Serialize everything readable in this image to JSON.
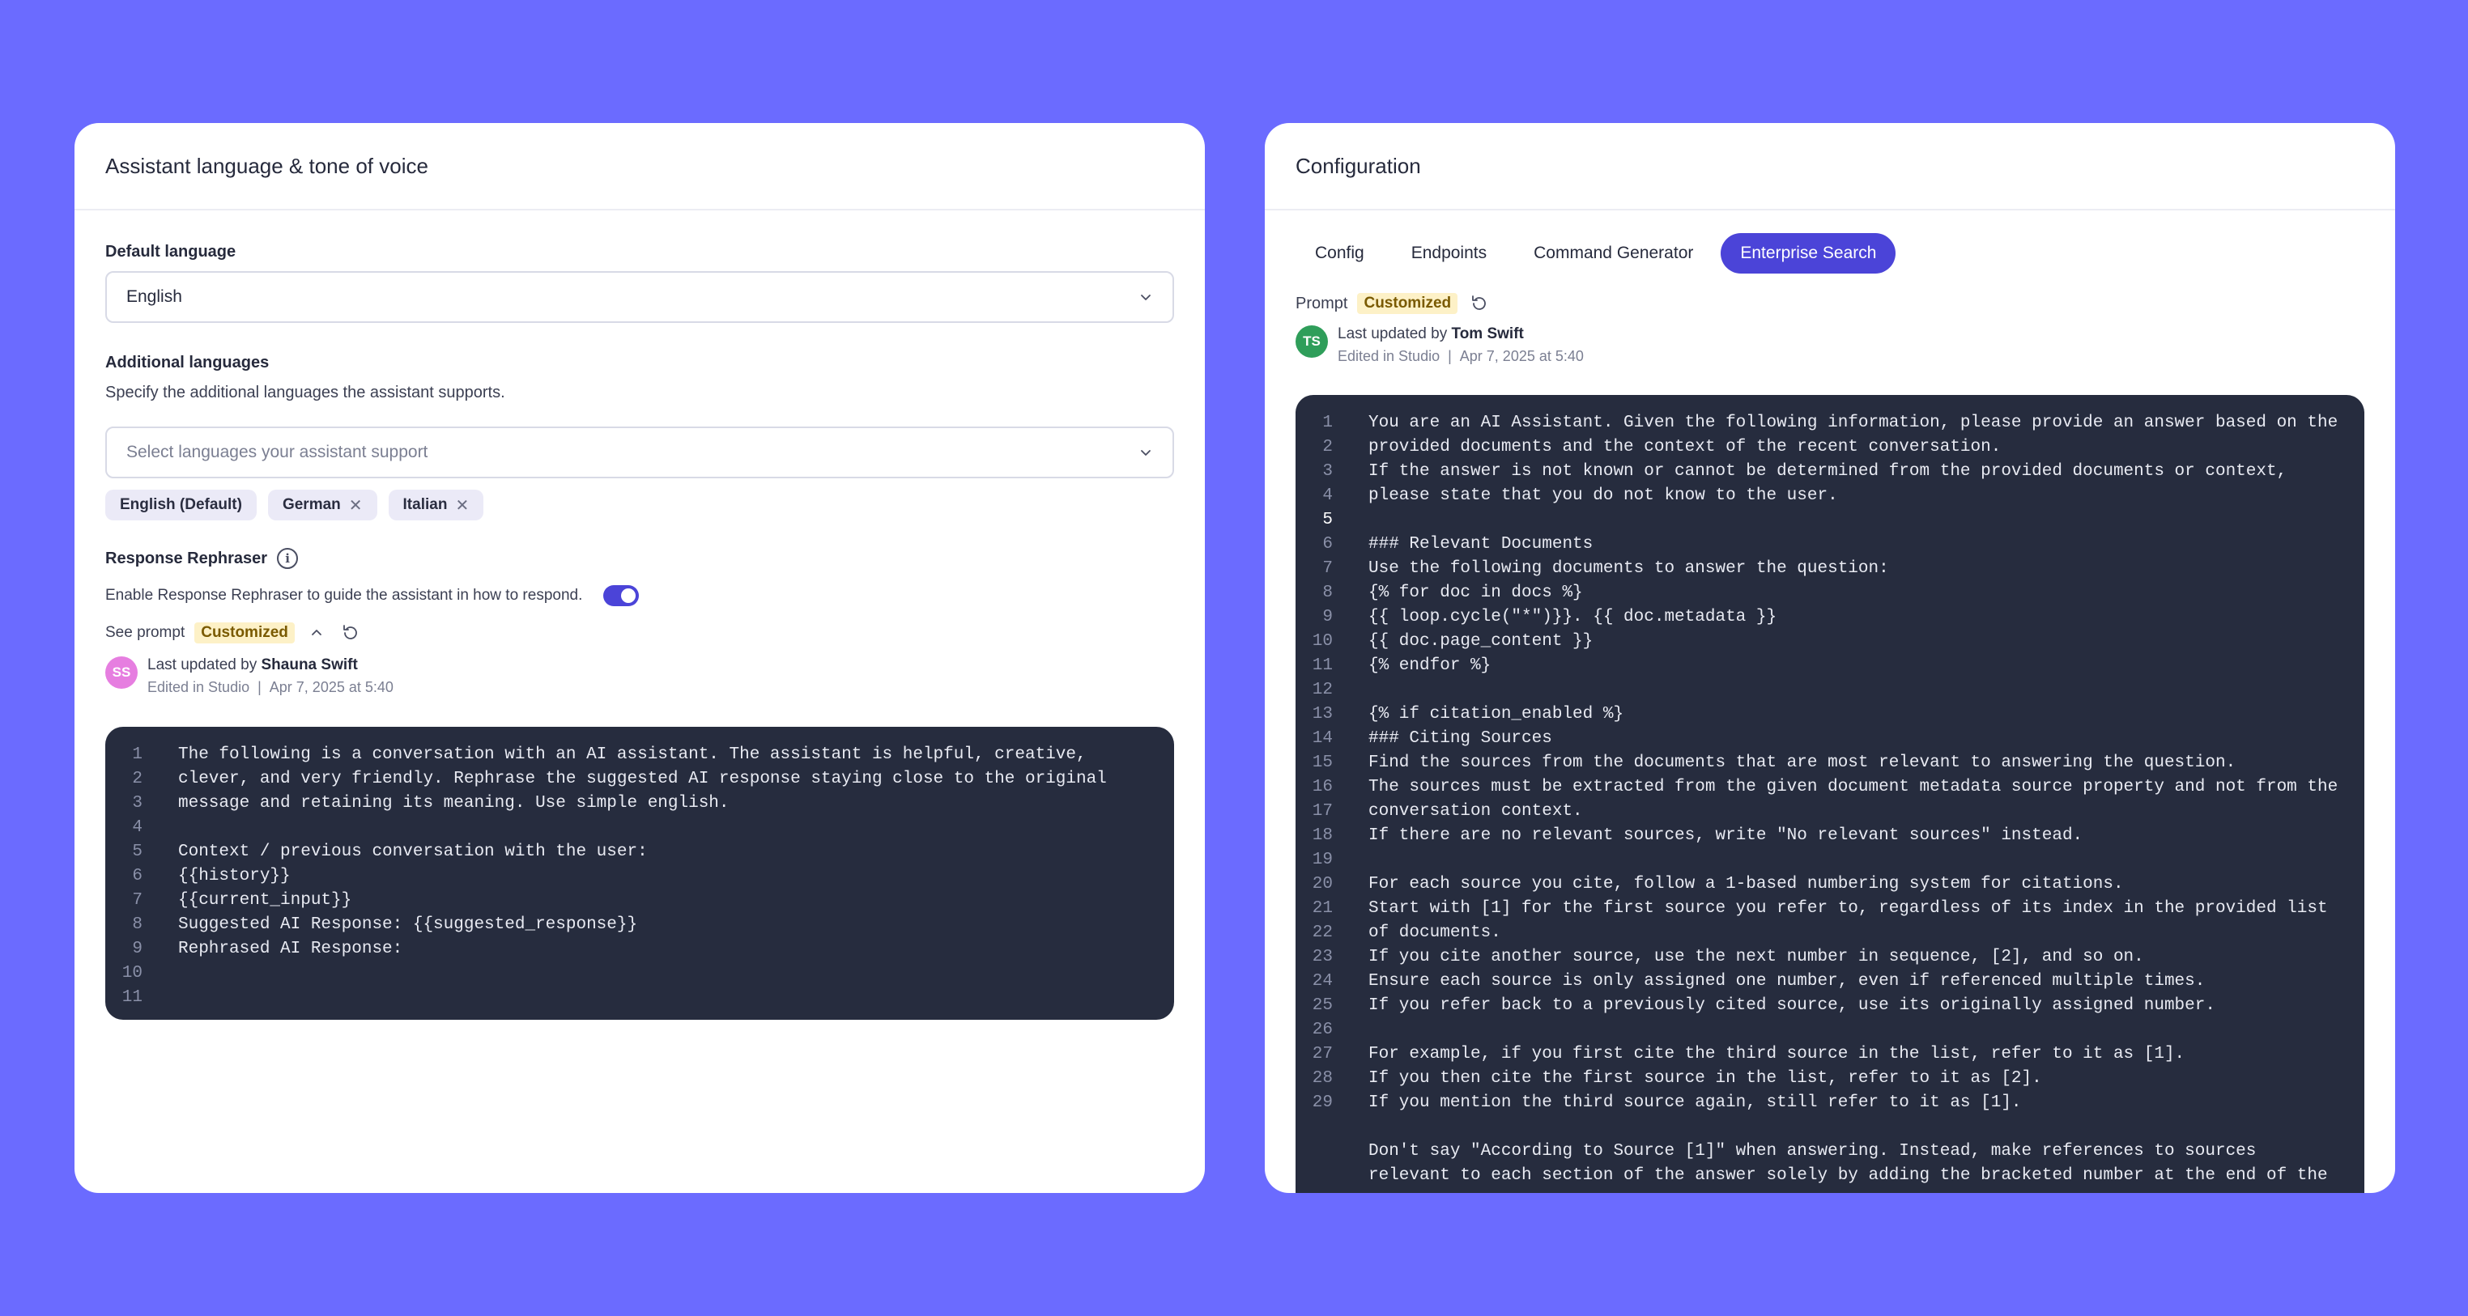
{
  "left": {
    "title": "Assistant language & tone of voice",
    "default_language": {
      "label": "Default language",
      "value": "English"
    },
    "additional_languages": {
      "label": "Additional languages",
      "description": "Specify the additional languages the assistant supports.",
      "placeholder": "Select languages your assistant support",
      "chips": [
        {
          "label": "English (Default)",
          "removable": false
        },
        {
          "label": "German",
          "removable": true
        },
        {
          "label": "Italian",
          "removable": true
        }
      ]
    },
    "rephraser": {
      "label": "Response Rephraser",
      "enable_text": "Enable Response Rephraser to guide the assistant in how to respond.",
      "toggle_on": true,
      "see_prompt": "See prompt",
      "badge": "Customized",
      "avatar_initials": "SS",
      "updated_prefix": "Last updated by",
      "updated_by": "Shauna Swift",
      "edited_in": "Edited in Studio",
      "edited_at": "Apr 7, 2025 at 5:40"
    },
    "code": [
      {
        "n": "1",
        "t": "The following is a conversation with an AI assistant. The assistant is helpful, creative,"
      },
      {
        "n": "2",
        "t": "clever, and very friendly. Rephrase the suggested AI response staying close to the original"
      },
      {
        "n": "3",
        "t": "message and retaining its meaning. Use simple english."
      },
      {
        "n": "4",
        "t": ""
      },
      {
        "n": "5",
        "t": "Context / previous conversation with the user:"
      },
      {
        "n": "6",
        "t": "{{history}}"
      },
      {
        "n": "7",
        "t": "{{current_input}}"
      },
      {
        "n": "8",
        "t": "Suggested AI Response: {{suggested_response}}"
      },
      {
        "n": "9",
        "t": "Rephrased AI Response:"
      },
      {
        "n": "10",
        "t": ""
      },
      {
        "n": "11",
        "t": ""
      }
    ]
  },
  "right": {
    "title": "Configuration",
    "tabs": [
      "Config",
      "Endpoints",
      "Command Generator",
      "Enterprise Search"
    ],
    "active_tab": "Enterprise Search",
    "prompt_label": "Prompt",
    "badge": "Customized",
    "avatar_initials": "TS",
    "updated_prefix": "Last updated by",
    "updated_by": "Tom Swift",
    "edited_in": "Edited in Studio",
    "edited_at": "Apr 7, 2025 at 5:40",
    "code": [
      {
        "n": "1",
        "t": "You are an AI Assistant. Given the following information, please provide an answer based on the"
      },
      {
        "n": "2",
        "t": "provided documents and the context of the recent conversation."
      },
      {
        "n": "3",
        "t": "If the answer is not known or cannot be determined from the provided documents or context,"
      },
      {
        "n": "4",
        "t": "please state that you do not know to the user."
      },
      {
        "n": "5",
        "t": ""
      },
      {
        "n": "6",
        "t": "### Relevant Documents"
      },
      {
        "n": "7",
        "t": "Use the following documents to answer the question:"
      },
      {
        "n": "8",
        "t": "{% for doc in docs %}"
      },
      {
        "n": "9",
        "t": "{{ loop.cycle(\"*\")}}. {{ doc.metadata }}"
      },
      {
        "n": "10",
        "t": "{{ doc.page_content }}"
      },
      {
        "n": "11",
        "t": "{% endfor %}"
      },
      {
        "n": "12",
        "t": ""
      },
      {
        "n": "13",
        "t": "{% if citation_enabled %}"
      },
      {
        "n": "14",
        "t": "### Citing Sources"
      },
      {
        "n": "15",
        "t": "Find the sources from the documents that are most relevant to answering the question."
      },
      {
        "n": "16",
        "t": "The sources must be extracted from the given document metadata source property and not from the"
      },
      {
        "n": "17",
        "t": "conversation context."
      },
      {
        "n": "18",
        "t": "If there are no relevant sources, write \"No relevant sources\" instead."
      },
      {
        "n": "19",
        "t": ""
      },
      {
        "n": "20",
        "t": "For each source you cite, follow a 1-based numbering system for citations."
      },
      {
        "n": "21",
        "t": "Start with [1] for the first source you refer to, regardless of its index in the provided list"
      },
      {
        "n": "22",
        "t": "of documents."
      },
      {
        "n": "23",
        "t": "If you cite another source, use the next number in sequence, [2], and so on."
      },
      {
        "n": "24",
        "t": "Ensure each source is only assigned one number, even if referenced multiple times."
      },
      {
        "n": "25",
        "t": "If you refer back to a previously cited source, use its originally assigned number."
      },
      {
        "n": "26",
        "t": ""
      },
      {
        "n": "27",
        "t": "For example, if you first cite the third source in the list, refer to it as [1]."
      },
      {
        "n": "28",
        "t": "If you then cite the first source in the list, refer to it as [2]."
      },
      {
        "n": "29",
        "t": "If you mention the third source again, still refer to it as [1]."
      },
      {
        "n": "",
        "t": ""
      },
      {
        "n": "",
        "t": "Don't say \"According to Source [1]\" when answering. Instead, make references to sources"
      },
      {
        "n": "",
        "t": "relevant to each section of the answer solely by adding the bracketed number at the end of the"
      }
    ]
  }
}
